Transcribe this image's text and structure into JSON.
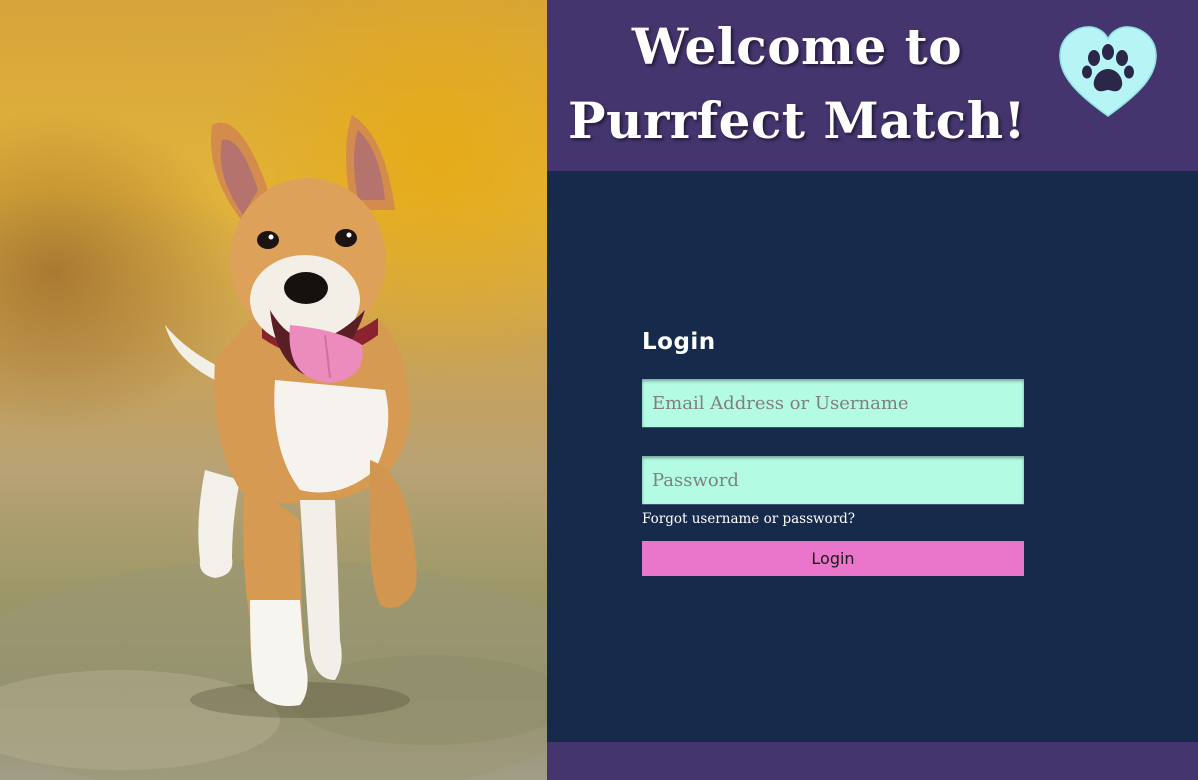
{
  "header": {
    "title_line1": "Welcome to",
    "title_line2": "Purrfect Match!",
    "logo_icon": "paw-heart-icon"
  },
  "hero_image": {
    "subject": "running-puppy-photo"
  },
  "login": {
    "heading": "Login",
    "email_placeholder": "Email Address or Username",
    "password_placeholder": "Password",
    "forgot_link": "Forgot username or password?",
    "button_label": "Login"
  },
  "colors": {
    "header_bg": "#45356f",
    "main_bg": "#162a4b",
    "input_bg": "#b4fbe4",
    "button_bg": "#ea76cc",
    "logo_heart": "#b7f4f6"
  }
}
